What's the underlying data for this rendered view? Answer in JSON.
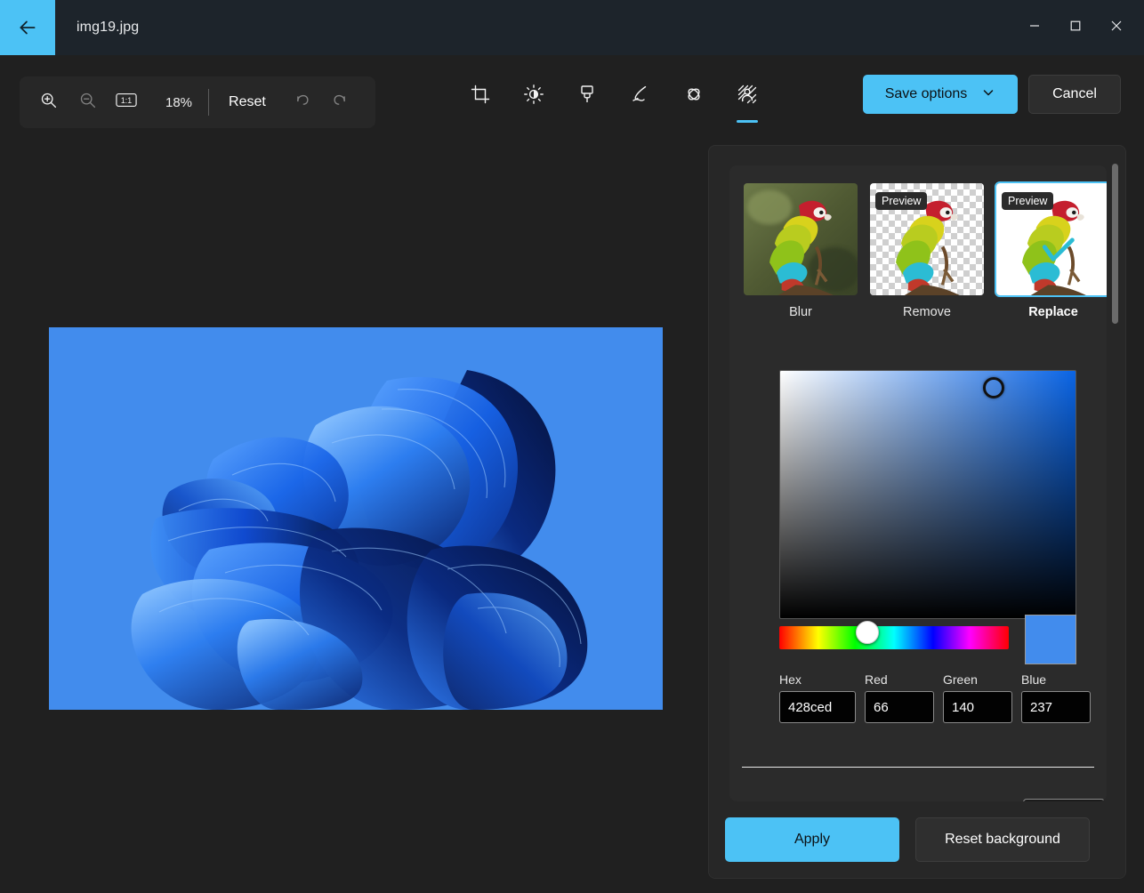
{
  "window": {
    "title": "img19.jpg",
    "back_icon": "arrow-left-icon",
    "minimize_label": "—",
    "maximize_label": "☐",
    "close_label": "✕"
  },
  "toolbar": {
    "zoom_in_icon": "zoom-in-icon",
    "zoom_out_icon": "zoom-out-icon",
    "actual_size_icon": "one-to-one-icon",
    "zoom_level": "18%",
    "reset_label": "Reset",
    "undo_icon": "undo-icon",
    "redo_icon": "redo-icon",
    "tools": [
      {
        "name": "crop",
        "icon": "crop-icon",
        "active": false
      },
      {
        "name": "adjustment",
        "icon": "brightness-icon",
        "active": false
      },
      {
        "name": "filters",
        "icon": "brush-icon",
        "active": false
      },
      {
        "name": "markup",
        "icon": "pen-icon",
        "active": false
      },
      {
        "name": "erase",
        "icon": "erase-objects-icon",
        "active": false
      },
      {
        "name": "background",
        "icon": "background-person-icon",
        "active": true
      }
    ],
    "save_options_label": "Save options",
    "save_options_chevron": "chevron-down-icon",
    "cancel_label": "Cancel"
  },
  "canvas": {
    "image_name": "img19.jpg",
    "background_color": "#428ced"
  },
  "panel": {
    "options": [
      {
        "label": "Blur",
        "badge": "",
        "selected": false,
        "style": "blur"
      },
      {
        "label": "Remove",
        "badge": "Preview",
        "selected": false,
        "style": "transparent"
      },
      {
        "label": "Replace",
        "badge": "Preview",
        "selected": true,
        "style": "solid"
      }
    ],
    "color_picker": {
      "sv_gradient_base": "#0a64e4",
      "hue_thumb_position_pct": 33,
      "swatch_color": "#428ced",
      "fields": [
        {
          "key": "hex",
          "label": "Hex",
          "value": "428ced"
        },
        {
          "key": "red",
          "label": "Red",
          "value": "66"
        },
        {
          "key": "green",
          "label": "Green",
          "value": "140"
        },
        {
          "key": "blue",
          "label": "Blue",
          "value": "237"
        }
      ]
    },
    "apply_label": "Apply",
    "reset_background_label": "Reset background"
  },
  "colors": {
    "accent": "#4cc2f5",
    "titlebar": "#1d242b",
    "canvas_bg": "#202020",
    "panel_bg": "#272727",
    "panel_inner_bg": "#2b2b2b"
  }
}
